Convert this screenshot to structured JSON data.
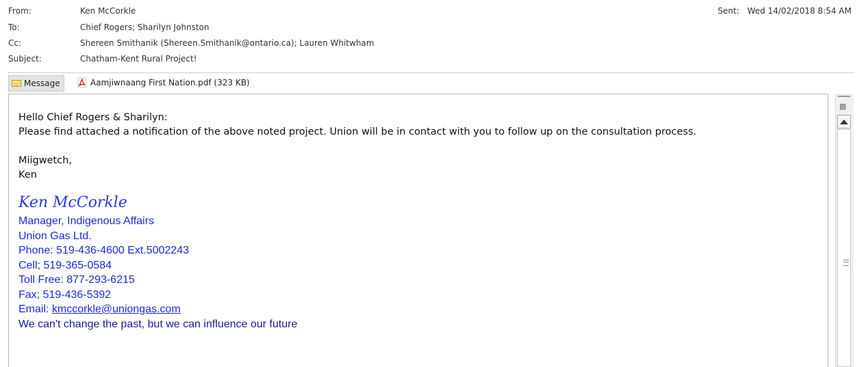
{
  "header": {
    "from_label": "From:",
    "from_value": "Ken McCorkle",
    "to_label": "To:",
    "to_value": "Chief Rogers; Sharilyn Johnston",
    "cc_label": "Cc:",
    "cc_value": "Shereen Smithanik (Shereen.Smithanik@ontario.ca); Lauren Whitwham",
    "subject_label": "Subject:",
    "subject_value": "Chatham-Kent Rural Project!",
    "sent_label": "Sent:",
    "sent_value": "Wed 14/02/2018 8:54 AM"
  },
  "attachments": {
    "message_tab": "Message",
    "pdf_file": "Aamjiwnaang First Nation.pdf (323 KB)"
  },
  "body": {
    "greeting": "Hello Chief Rogers & Sharilyn:",
    "line1": "Please find attached a notification of the above noted project. Union will be in contact with you to follow up on the consultation process.",
    "closing": "Miigwetch,",
    "sign_short": "Ken"
  },
  "signature": {
    "name": "Ken McCorkle",
    "title": "Manager, Indigenous Affairs",
    "company": "Union Gas Ltd.",
    "phone": "Phone: 519-436-4600 Ext.5002243",
    "cell": "Cell; 519-365-0584",
    "tollfree": "Toll Free: 877-293-6215",
    "fax": "Fax; 519-436-5392",
    "email_label": "Email: ",
    "email": "kmccorkle@uniongas.com",
    "motto": "We can't change the past, but we can influence our future"
  },
  "colors": {
    "signature_blue": "#1f28d8",
    "motto_navy": "#1c1c98"
  },
  "icons": [
    "envelope-icon",
    "pdf-icon",
    "up-arrow-icon"
  ]
}
